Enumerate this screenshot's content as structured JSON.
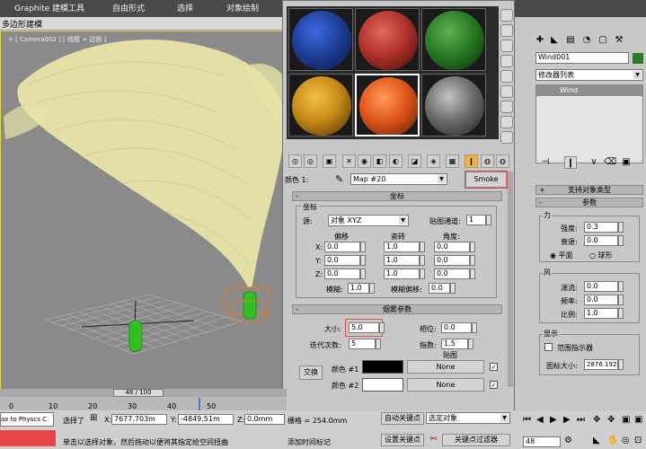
{
  "ribbon": {
    "tabs": [
      "Graphite 建模工具",
      "自由形式",
      "选择",
      "对象绘制"
    ],
    "sub_label": "多边形建模"
  },
  "viewport": {
    "label": "+ [ Camera002 ] [ 线框 + 边面 ]"
  },
  "material_editor": {
    "slots": [
      {
        "name": "blue",
        "color": "#1f3f9a"
      },
      {
        "name": "red",
        "color": "#b3322c"
      },
      {
        "name": "green",
        "color": "#2a7d25"
      },
      {
        "name": "gold",
        "color": "#c98b16"
      },
      {
        "name": "orange-dotted",
        "color": "#e0561a"
      },
      {
        "name": "gray",
        "color": "#6e6e6e"
      }
    ],
    "color_label": "颜色 1:",
    "map_value": "Map #20",
    "map_type_button": "Smoke",
    "coords_rollout": {
      "title": "坐标",
      "group_title": "坐标",
      "source_label": "源:",
      "source_value": "对象 XYZ",
      "map_channel_label": "贴图通道:",
      "map_channel_value": "1",
      "offset_header": "偏移",
      "tiling_header": "瓷砖",
      "angle_header": "角度:",
      "axes": [
        "X:",
        "Y:",
        "Z:"
      ],
      "offset": [
        "0.0",
        "0.0",
        "0.0"
      ],
      "tiling": [
        "1.0",
        "1.0",
        "1.0"
      ],
      "angle": [
        "0.0",
        "0.0",
        "0.0"
      ],
      "blur_label": "模糊:",
      "blur_value": "1.0",
      "blur_offset_label": "模糊偏移:",
      "blur_offset_value": "0.0"
    },
    "smoke_rollout": {
      "title": "烟雾参数",
      "size_label": "大小:",
      "size_value": "5.0",
      "phase_label": "相位:",
      "phase_value": "0.0",
      "iterations_label": "迭代次数:",
      "iterations_value": "5",
      "exponent_label": "指数:",
      "exponent_value": "1.5",
      "maps_label": "贴图",
      "swap_button": "交换",
      "color1_label": "颜色 #1",
      "color2_label": "颜色 #2",
      "none1": "None",
      "none2": "None",
      "color1": "#000000",
      "color2": "#ffffff"
    }
  },
  "command_panel": {
    "object_name": "Wind001",
    "modifier_list": "修改器列表",
    "stack_item": "Wind",
    "support_rollout": "支持对象类型",
    "params_rollout": "参数",
    "force_group": "力",
    "strength_label": "强度:",
    "strength_value": "0.3",
    "decay_label": "衰退:",
    "decay_value": "0.0",
    "planar_label": "平面",
    "spherical_label": "球形",
    "wind_group": "风",
    "turbulence_label": "湍流:",
    "turbulence_value": "0.0",
    "frequency_label": "频率:",
    "frequency_value": "0.0",
    "scale_label": "比例:",
    "scale_value": "1.0",
    "display_group": "显示",
    "range_indicator_label": "范围指示器",
    "icon_size_label": "图标大小:",
    "icon_size_value": "2876.192"
  },
  "timeline": {
    "frame_display": "48 / 100",
    "ticks": [
      "0",
      "10",
      "20",
      "30",
      "40",
      "50"
    ],
    "progress": 0.48
  },
  "status": {
    "physics_label": "ax to Physcs C",
    "selected_label": "选择了",
    "x_label": "X:",
    "x_value": "7677.703m",
    "y_label": "Y:",
    "y_value": "-4849.51m",
    "z_label": "Z:",
    "z_value": "0.0mm",
    "grid_label": "栅格 = 254.0mm",
    "autokey_label": "自动关键点",
    "selected_object": "选定对象",
    "set_key_label": "设置关键点",
    "key_filters_label": "关键点过滤器",
    "prompt": "单击以选择对象，然后拖动以便将其指定给空间扭曲",
    "add_tag": "添加时间标记",
    "frame_value": "48"
  }
}
